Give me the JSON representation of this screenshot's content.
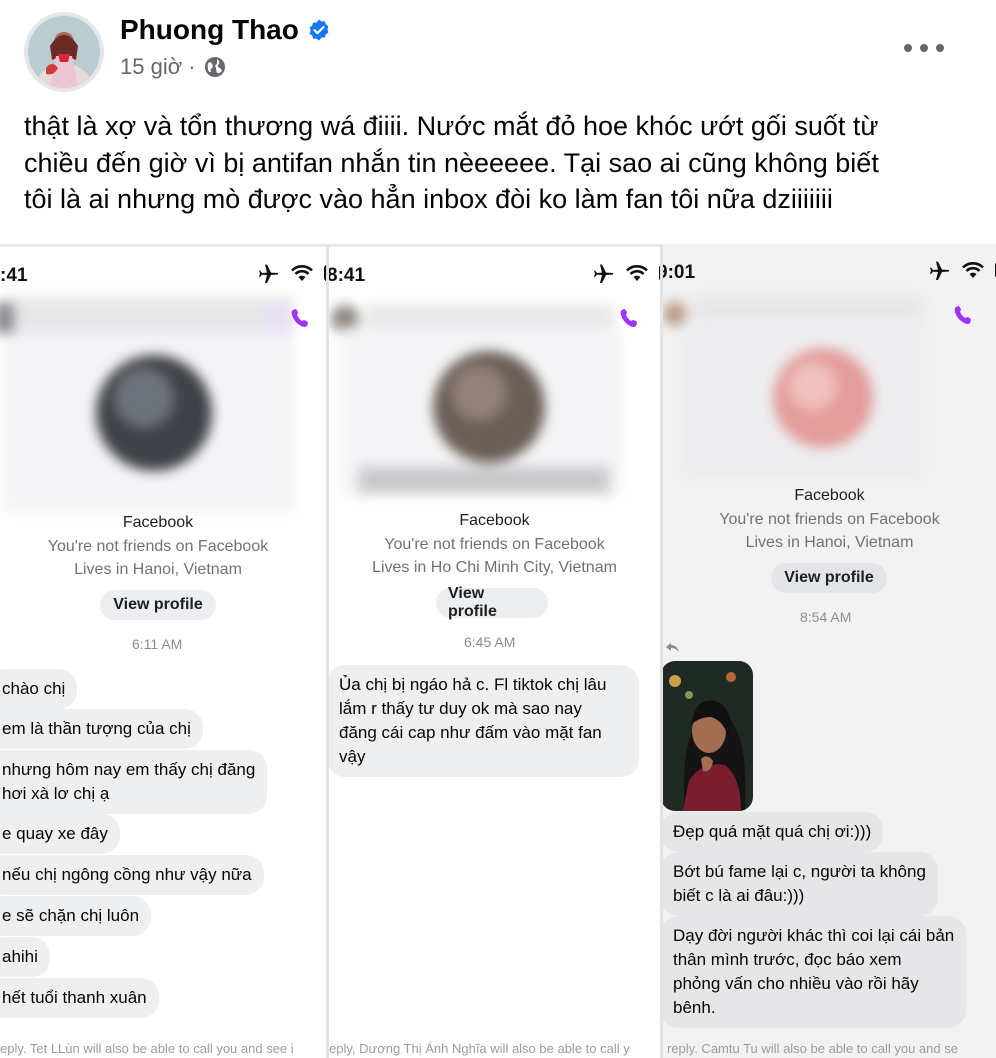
{
  "post": {
    "author": "Phuong Thao",
    "time": "15 giờ ·",
    "text": "thật là xợ và tổn thương wá điiii. Nước mắt đỏ hoe khóc ướt gối suốt từ\nchiều đến giờ vì bị antifan nhắn tin nèeeeee. Tại sao ai cũng không biết\ntôi là ai nhưng mò được vào hẳn inbox đòi ko làm fan tôi nữa dziiiiiii",
    "icons": [
      "verified-badge-icon",
      "globe-icon",
      "more-options-icon"
    ]
  },
  "screenshots": [
    {
      "status_time": ":41",
      "source": "Facebook",
      "not_friends": "You're not friends on Facebook",
      "lives": "Lives in Hanoi, Vietnam",
      "view_profile": "View profile",
      "time": "6:11 AM",
      "messages": [
        "chào chị",
        "em là thần tượng của chị",
        "nhưng hôm nay em thấy chị đăng\nhơi xà lơ chị ạ",
        "e quay xe đây",
        "nếu chị ngông cồng như vậy nữa",
        "e sẽ chặn chị luôn",
        "ahihi",
        "hết tuổi thanh xuân"
      ],
      "footer": "eply. Tet LLùn will also be able to call you and see i"
    },
    {
      "status_time": "8:41",
      "source": "Facebook",
      "not_friends": "You're not friends on Facebook",
      "lives": "Lives in Ho Chi Minh City, Vietnam",
      "view_profile": "View profile",
      "time": "6:45 AM",
      "messages": [
        "Ủa chị bị ngáo hả c. Fl tiktok chị lâu\nlắm r thấy tư duy ok mà sao nay\nđăng cái cap như đấm vào mặt fan\nvậy"
      ],
      "footer": "eply, Dương Thị Ánh Nghĩa will also be able to call y"
    },
    {
      "status_time": "9:01",
      "source": "Facebook",
      "not_friends": "You're not friends on Facebook",
      "lives": "Lives in Hanoi, Vietnam",
      "view_profile": "View profile",
      "time": "8:54 AM",
      "messages": [
        "Đẹp quá mặt quá chị ơi:)))",
        "Bớt bú fame lại c, người ta không\nbiết c là ai đâu:)))",
        "Dạy đời người khác thì coi lại cái bản\nthân mình trước, đọc báo xem\nphỏng vấn cho nhiều vào rồi hãy\nbênh."
      ],
      "footer": "reply. Camtu Tu will also be able to call you and se"
    }
  ],
  "colors": {
    "accent": "#1877f2",
    "call": "#a033ff",
    "bubble": "#eeeff1"
  }
}
